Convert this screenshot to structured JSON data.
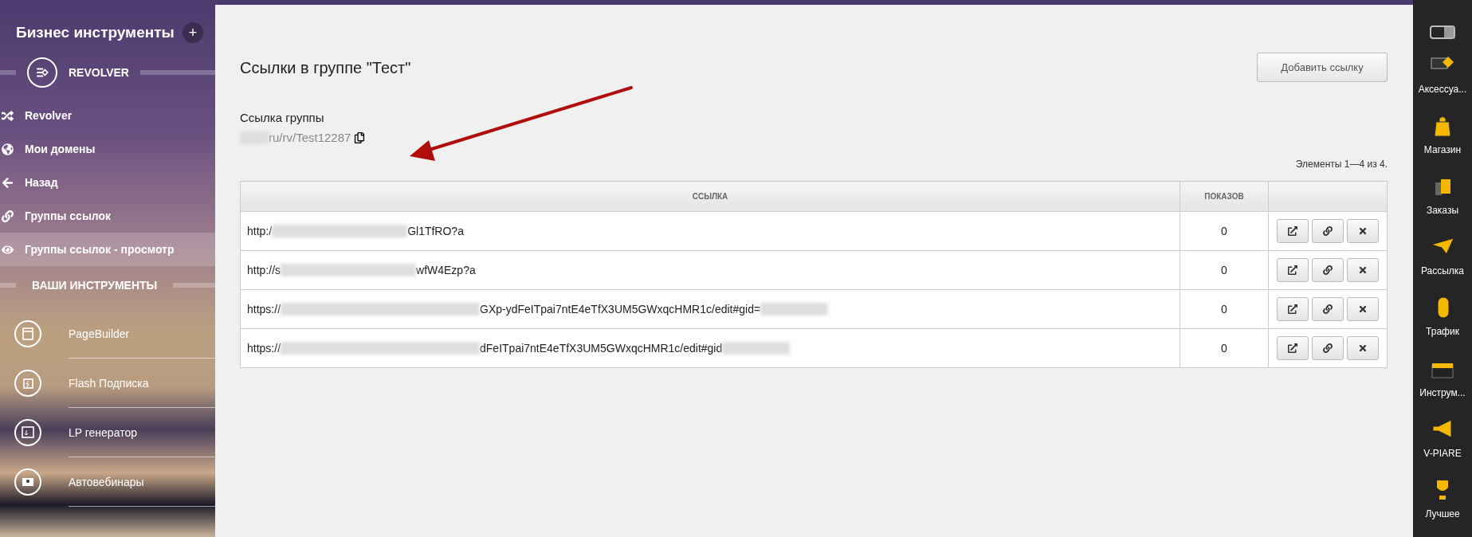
{
  "sidebar": {
    "title": "Бизнес инструменты",
    "add_button": "+",
    "section": {
      "label": "REVOLVER"
    },
    "menu": [
      {
        "label": "Revolver",
        "selected": false
      },
      {
        "label": "Мои домены",
        "selected": false
      },
      {
        "label": "Назад",
        "selected": false
      },
      {
        "label": "Группы ссылок",
        "selected": false
      },
      {
        "label": "Группы ссылок - просмотр",
        "selected": true
      }
    ],
    "tools_heading": "ВАШИ ИНСТРУМЕНТЫ",
    "tools": [
      {
        "label": "PageBuilder"
      },
      {
        "label": "Flash Подписка"
      },
      {
        "label": "LP генератор"
      },
      {
        "label": "Автовебинары"
      }
    ]
  },
  "main": {
    "title": "Ссылки в группе \"Тест\"",
    "add_button": "Добавить ссылку",
    "group_link_label": "Ссылка группы",
    "group_link_url": "ru/rv/Test12287",
    "counter": "Элементы 1—4 из 4.",
    "table": {
      "columns": [
        "ССЫЛКА",
        "ПОКАЗОВ"
      ],
      "rows": [
        {
          "url_start": "http:/",
          "url_end": "Gl1TfRO?a",
          "views": "0"
        },
        {
          "url_start": "http://s",
          "url_end": "wfW4Ezp?a",
          "views": "0"
        },
        {
          "url_start": "https://",
          "url_end": "GXp-ydFeITpai7ntE4eTfX3UM5GWxqcHMR1c/edit#gid=",
          "views": "0"
        },
        {
          "url_start": "https://",
          "url_end": "dFeITpai7ntE4eTfX3UM5GWxqcHMR1c/edit#gid",
          "views": "0"
        }
      ]
    }
  },
  "dock": {
    "toggle": {
      "on": true
    },
    "items": [
      {
        "label": "Аксессуа..."
      },
      {
        "label": "Магазин"
      },
      {
        "label": "Заказы"
      },
      {
        "label": "Рассылка"
      },
      {
        "label": "Трафик"
      },
      {
        "label": "Инструм..."
      },
      {
        "label": "V-PIARE"
      },
      {
        "label": "Лучшее"
      }
    ]
  }
}
